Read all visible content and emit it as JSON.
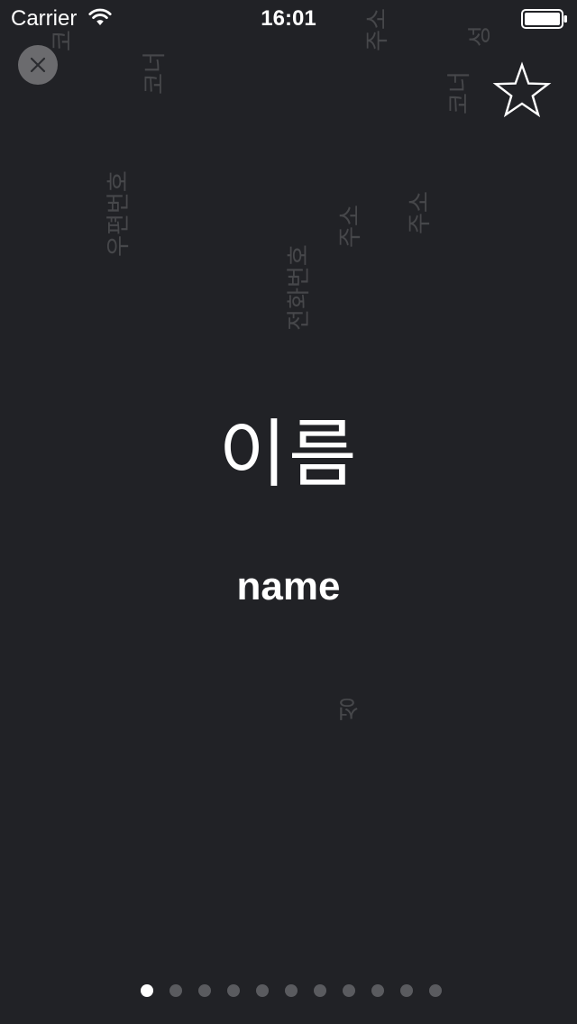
{
  "status_bar": {
    "carrier": "Carrier",
    "time": "16:01"
  },
  "controls": {
    "close_icon": "close-icon",
    "favorite_icon": "star-outline-icon"
  },
  "card": {
    "word": "이름",
    "translation": "name"
  },
  "background_words": [
    {
      "text": "코너"
    },
    {
      "text": "우편번호"
    },
    {
      "text": "전화번호"
    },
    {
      "text": "주소"
    },
    {
      "text": "주소"
    },
    {
      "text": "코너"
    },
    {
      "text": "성"
    },
    {
      "text": "주소"
    },
    {
      "text": "성"
    },
    {
      "text": "코"
    }
  ],
  "pager": {
    "total": 11,
    "current": 1
  },
  "colors": {
    "background": "#212226",
    "foreground": "#ffffff",
    "dot_inactive": "#5a5b5f",
    "close_bg": "#6b6b6e"
  }
}
